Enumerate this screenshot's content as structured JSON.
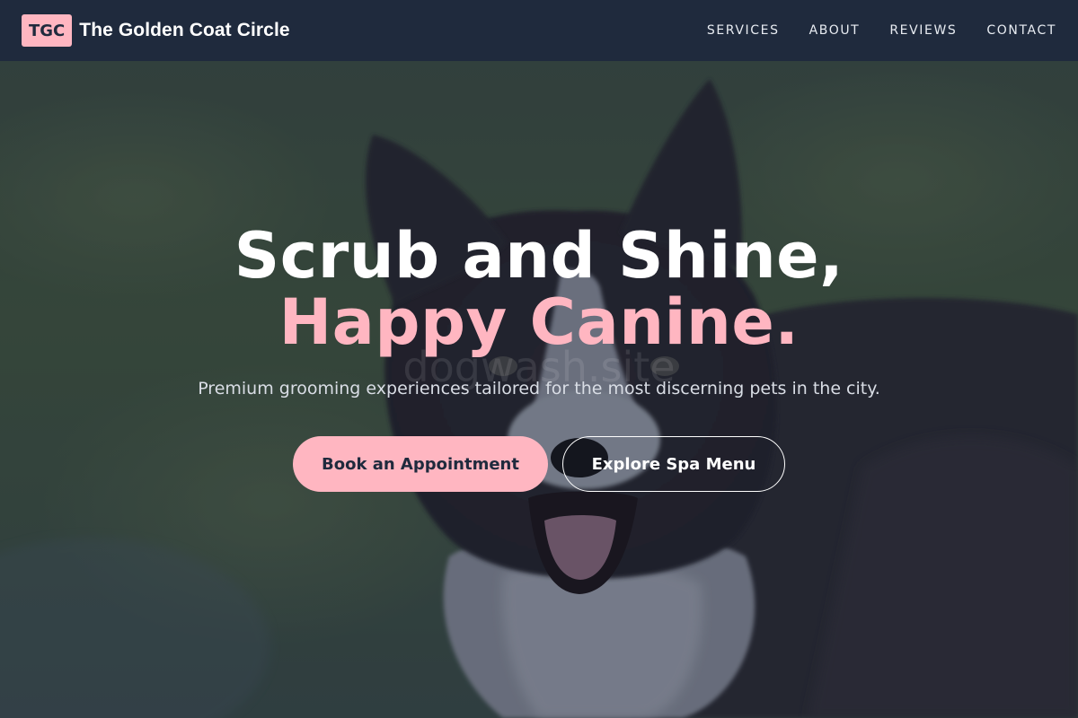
{
  "brand": {
    "badge": "TGC",
    "name": "The Golden Coat Circle"
  },
  "nav": {
    "items": [
      {
        "label": "SERVICES"
      },
      {
        "label": "ABOUT"
      },
      {
        "label": "REVIEWS"
      },
      {
        "label": "CONTACT"
      }
    ]
  },
  "hero": {
    "headline_line1": "Scrub and Shine,",
    "headline_line2": "Happy Canine.",
    "watermark": "dogwash.site",
    "subtitle": "Premium grooming experiences tailored for the most discerning pets in the city.",
    "primary_cta": "Book an Appointment",
    "secondary_cta": "Explore Spa Menu",
    "background_subject": "dog-photo"
  },
  "colors": {
    "nav_bg": "#1f2a3d",
    "accent_pink": "#ffb6c1",
    "text_white": "#ffffff"
  }
}
